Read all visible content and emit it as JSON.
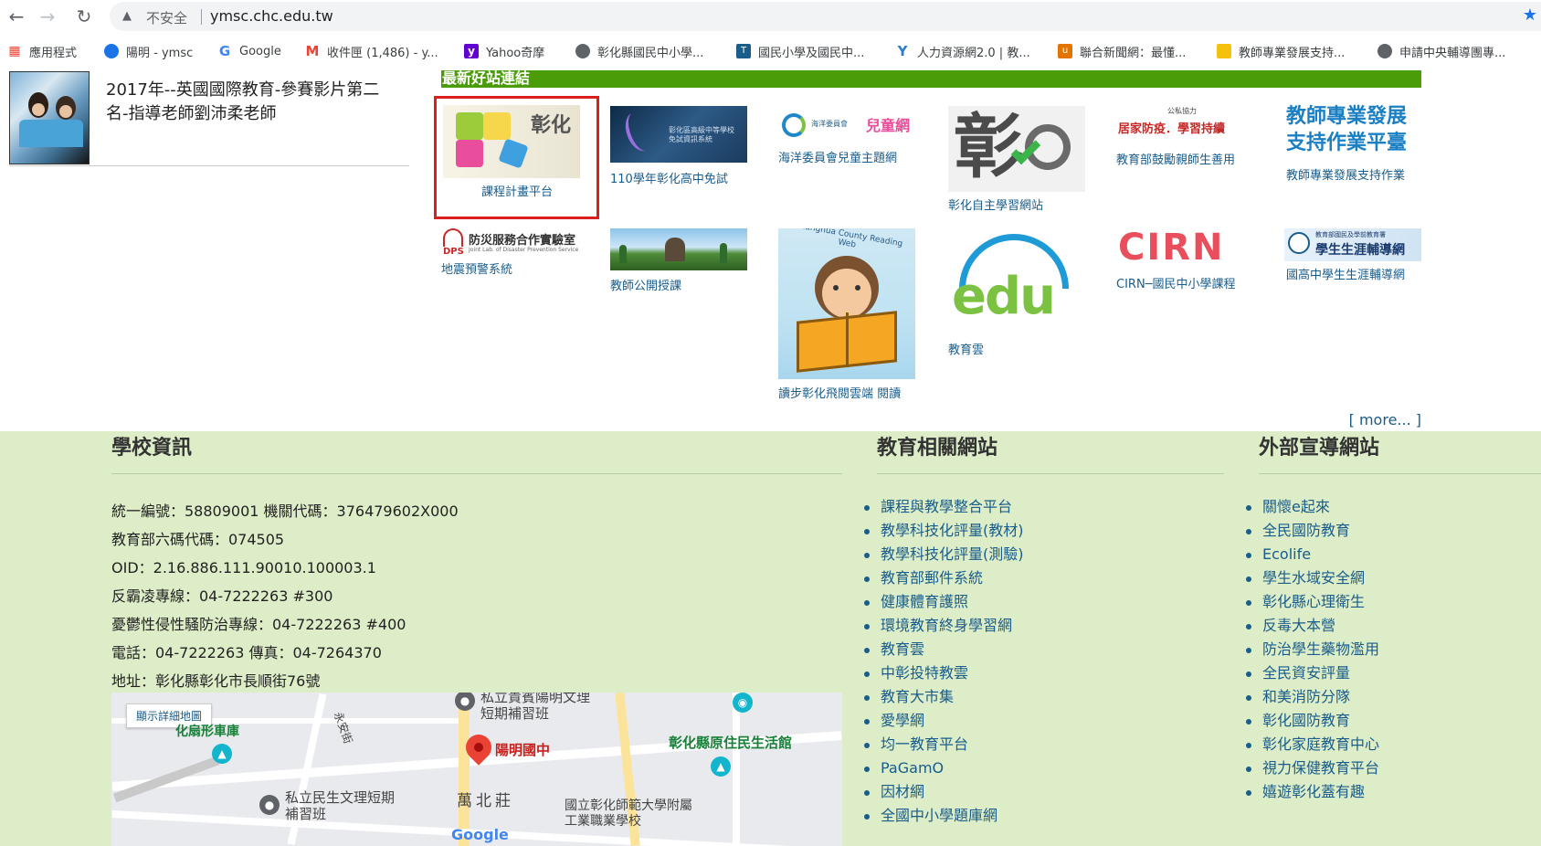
{
  "browser": {
    "insecure_label": "不安全",
    "url": "ymsc.chc.edu.tw",
    "bookmarks": [
      {
        "label": "應用程式",
        "icon": "apps-grid-icon",
        "color": "#ea4335"
      },
      {
        "label": "陽明 - ymsc",
        "icon": "globe-icon",
        "color": "#1a73e8"
      },
      {
        "label": "Google",
        "icon": "google-g-icon",
        "color": "#4285f4"
      },
      {
        "label": "收件匣 (1,486) - y...",
        "icon": "gmail-icon",
        "color": "#ea4335"
      },
      {
        "label": "Yahoo奇摩",
        "icon": "yahoo-icon",
        "color": "#6001d2"
      },
      {
        "label": "彰化縣國民中小學...",
        "icon": "globe-icon",
        "color": "#5f6368"
      },
      {
        "label": "國民小學及國民中...",
        "icon": "site-icon",
        "color": "#1a5c8a"
      },
      {
        "label": "人力資源網2.0 | 教...",
        "icon": "y-logo-icon",
        "color": "#2e7bd1"
      },
      {
        "label": "聯合新聞網：最懂...",
        "icon": "udn-icon",
        "color": "#e37400"
      },
      {
        "label": "教師專業發展支持...",
        "icon": "folder-icon",
        "color": "#f4c20d"
      },
      {
        "label": "申請中央輔導團專...",
        "icon": "globe-icon",
        "color": "#5f6368"
      }
    ]
  },
  "news": {
    "title": "2017年--英國國際教育-參賽影片第二名-指導老師劉沛柔老師"
  },
  "links_section": {
    "title": "最新好站連結",
    "more": "[ more... ]",
    "cards": [
      {
        "caption": "課程計畫平台",
        "img_text": "彰化"
      },
      {
        "caption": "110學年彰化高中免試",
        "img_text": "彰化區高級中等學校 免試資訊系統"
      },
      {
        "caption": "海洋委員會兒童主題網",
        "img_text": "兒童網"
      },
      {
        "caption": "彰化自主學習網站",
        "img_text": "彰"
      },
      {
        "caption": "教育部鼓勵親師生善用",
        "img_text": "居家防疫．學習持續"
      },
      {
        "caption": "教師專業發展支持作業",
        "img_text": "教師專業發展支持作業平臺"
      },
      {
        "caption": "地震預警系統",
        "img_text": "防災服務合作實驗室"
      },
      {
        "caption": "教師公開授課",
        "img_text": ""
      },
      {
        "caption": "讀步彰化飛閱雲端 閱讀",
        "img_text": "Changhua County Reading Web"
      },
      {
        "caption": "教育雲",
        "img_text": "edu"
      },
      {
        "caption": "CIRN─國民中小學課程",
        "img_text": "CIRN"
      },
      {
        "caption": "國高中學生生涯輔導網",
        "img_text": "學生生涯輔導網"
      }
    ]
  },
  "footer": {
    "school": {
      "heading": "學校資訊",
      "lines": [
        "統一編號：58809001  機關代碼：376479602X000",
        "教育部六碼代碼：074505",
        "OID：2.16.886.111.90010.100003.1",
        "反霸凌專線：04-7222263 #300",
        "憂鬱性侵性騷防治專線：04-7222263 #400",
        "電話：04-7222263  傳真：04-7264370",
        "地址：彰化縣彰化市長順街76號"
      ]
    },
    "edu": {
      "heading": "教育相關網站",
      "items": [
        "課程與教學整合平台",
        "教學科技化評量(教材)",
        "教學科技化評量(測驗)",
        "教育部郵件系統",
        "健康體育護照",
        "環境教育終身學習網",
        "教育雲",
        "中彰投特教雲",
        "教育大市集",
        "愛學網",
        "均一教育平台",
        "PaGamO",
        "因材網",
        "全國中小學題庫網"
      ]
    },
    "external": {
      "heading": "外部宣導網站",
      "items": [
        "關懷e起來",
        "全民國防教育",
        "Ecolife",
        "學生水域安全網",
        "彰化縣心理衛生",
        "反毒大本營",
        "防治學生藥物濫用",
        "全民資安評量",
        "和美消防分隊",
        "彰化國防教育",
        "彰化家庭教育中心",
        "視力保健教育平台",
        "嬉遊彰化蓋有趣"
      ]
    },
    "map": {
      "button": "顯示詳細地圖",
      "labels": [
        "私立貴賓陽明文理短期補習班",
        "陽明國中",
        "彰化縣原住民生活館",
        "萬北莊",
        "國立彰化師範大學附屬工業職業學校",
        "私立民生文理短期補習班",
        "化扇形車庫",
        "永安街",
        "Google"
      ]
    }
  }
}
